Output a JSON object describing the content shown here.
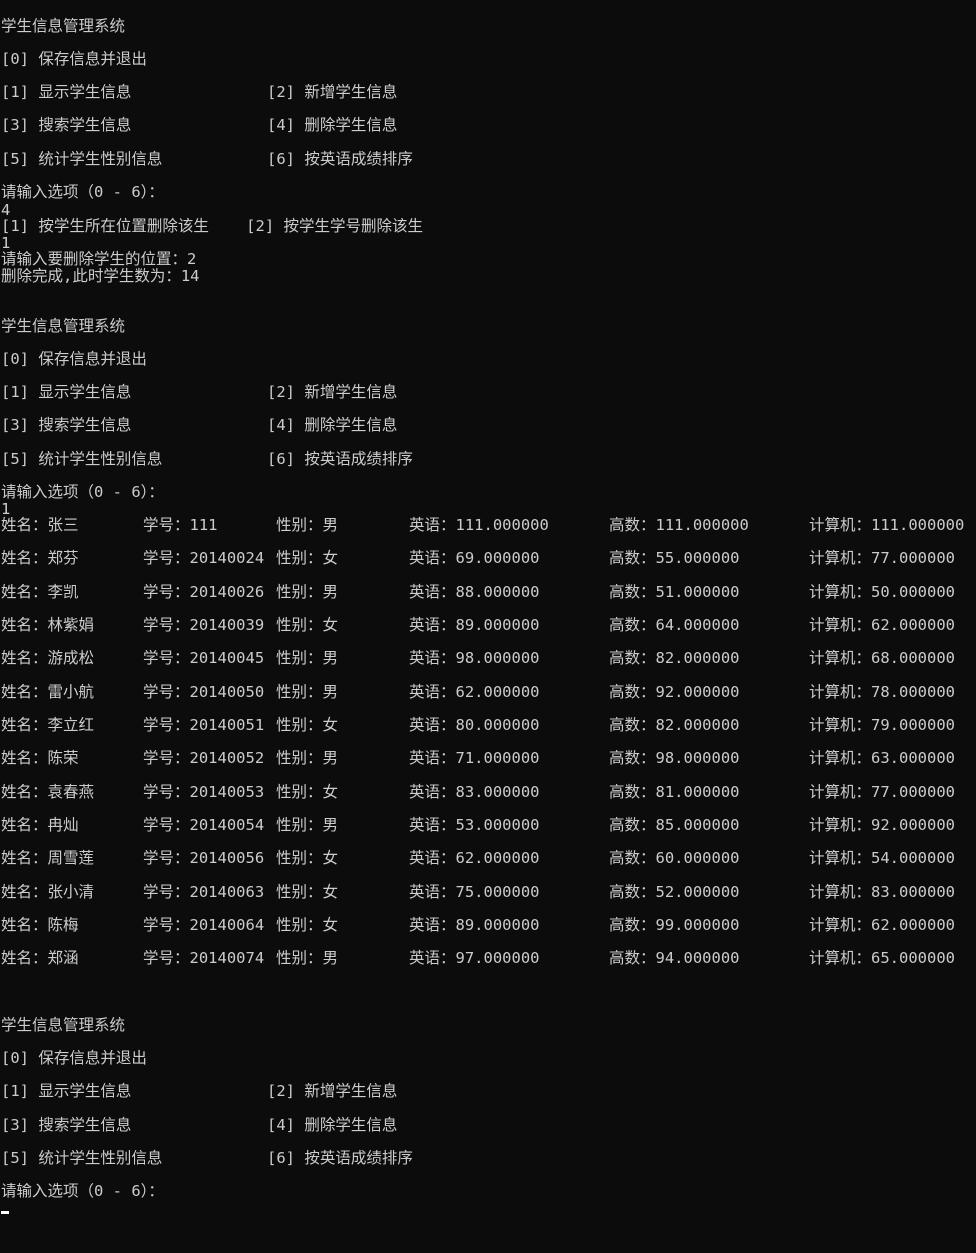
{
  "menu": {
    "title": "学生信息管理系统",
    "opt0": "[0] 保存信息并退出",
    "opt1": "[1] 显示学生信息",
    "opt2": "[2] 新增学生信息",
    "opt3": "[3] 搜索学生信息",
    "opt4": "[4] 删除学生信息",
    "opt5": "[5] 统计学生性别信息",
    "opt6": "[6] 按英语成绩排序",
    "prompt": "请输入选项（0 - 6）："
  },
  "session1": {
    "choice": "4",
    "delete_options": "[1] 按学生所在位置删除该生    [2] 按学生学号删除该生",
    "delete_choice": "1",
    "position_prompt": "请输入要删除学生的位置：2",
    "done_message": "删除完成,此时学生数为：14"
  },
  "session2": {
    "choice": "1"
  },
  "students": [
    {
      "name": "姓名：张三",
      "id": "学号：111",
      "gender": "性别：男",
      "english": "英语：111.000000",
      "math": "高数：111.000000",
      "computer": "计算机：111.000000"
    },
    {
      "name": "姓名：郑芬",
      "id": "学号：20140024",
      "gender": "性别：女",
      "english": "英语：69.000000",
      "math": "高数：55.000000",
      "computer": "计算机：77.000000"
    },
    {
      "name": "姓名：李凯",
      "id": "学号：20140026",
      "gender": "性别：男",
      "english": "英语：88.000000",
      "math": "高数：51.000000",
      "computer": "计算机：50.000000"
    },
    {
      "name": "姓名：林紫娟",
      "id": "学号：20140039",
      "gender": "性别：女",
      "english": "英语：89.000000",
      "math": "高数：64.000000",
      "computer": "计算机：62.000000"
    },
    {
      "name": "姓名：游成松",
      "id": "学号：20140045",
      "gender": "性别：男",
      "english": "英语：98.000000",
      "math": "高数：82.000000",
      "computer": "计算机：68.000000"
    },
    {
      "name": "姓名：雷小航",
      "id": "学号：20140050",
      "gender": "性别：男",
      "english": "英语：62.000000",
      "math": "高数：92.000000",
      "computer": "计算机：78.000000"
    },
    {
      "name": "姓名：李立红",
      "id": "学号：20140051",
      "gender": "性别：女",
      "english": "英语：80.000000",
      "math": "高数：82.000000",
      "computer": "计算机：79.000000"
    },
    {
      "name": "姓名：陈荣",
      "id": "学号：20140052",
      "gender": "性别：男",
      "english": "英语：71.000000",
      "math": "高数：98.000000",
      "computer": "计算机：63.000000"
    },
    {
      "name": "姓名：袁春燕",
      "id": "学号：20140053",
      "gender": "性别：女",
      "english": "英语：83.000000",
      "math": "高数：81.000000",
      "computer": "计算机：77.000000"
    },
    {
      "name": "姓名：冉灿",
      "id": "学号：20140054",
      "gender": "性别：男",
      "english": "英语：53.000000",
      "math": "高数：85.000000",
      "computer": "计算机：92.000000"
    },
    {
      "name": "姓名：周雪莲",
      "id": "学号：20140056",
      "gender": "性别：女",
      "english": "英语：62.000000",
      "math": "高数：60.000000",
      "computer": "计算机：54.000000"
    },
    {
      "name": "姓名：张小清",
      "id": "学号：20140063",
      "gender": "性别：女",
      "english": "英语：75.000000",
      "math": "高数：52.000000",
      "computer": "计算机：83.000000"
    },
    {
      "name": "姓名：陈梅",
      "id": "学号：20140064",
      "gender": "性别：女",
      "english": "英语：89.000000",
      "math": "高数：99.000000",
      "computer": "计算机：62.000000"
    },
    {
      "name": "姓名：郑涵",
      "id": "学号：20140074",
      "gender": "性别：男",
      "english": "英语：97.000000",
      "math": "高数：94.000000",
      "computer": "计算机：65.000000"
    }
  ]
}
